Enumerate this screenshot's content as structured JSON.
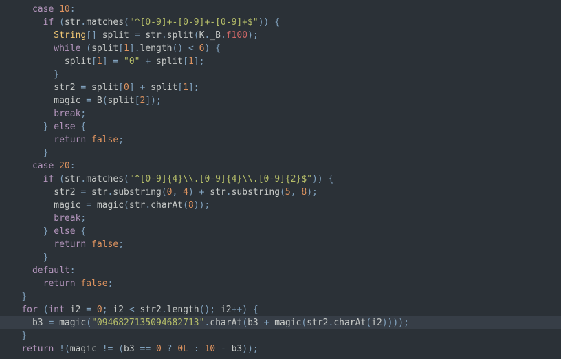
{
  "code": {
    "l1": "      case 10:",
    "l2": "        if (str.matches(\"^[0-9]+-[0-9]+-[0-9]+$\")) {",
    "l3": "          String[] split = str.split(K._B.f100);",
    "l4": "          while (split[1].length() < 6) {",
    "l5": "            split[1] = \"0\" + split[1];",
    "l6": "          }",
    "l7": "          str2 = split[0] + split[1];",
    "l8": "          magic = B(split[2]);",
    "l9": "          break;",
    "l10": "        } else {",
    "l11": "          return false;",
    "l12": "        }",
    "l13": "      case 20:",
    "l14": "        if (str.matches(\"^[0-9]{4}\\\\.[0-9]{4}\\\\.[0-9]{2}$\")) {",
    "l15": "          str2 = str.substring(0, 4) + str.substring(5, 8);",
    "l16": "          magic = magic(str.charAt(8));",
    "l17": "          break;",
    "l18": "        } else {",
    "l19": "          return false;",
    "l20": "        }",
    "l21": "      default:",
    "l22": "        return false;",
    "l23": "    }",
    "l24": "    for (int i2 = 0; i2 < str2.length(); i2++) {",
    "l25": "      b3 = magic(\"0946827135094682713\".charAt(b3 + magic(str2.charAt(i2))));",
    "l26": "    }",
    "l27": "    return !(magic != (b3 == 0 ? 0L : 10 - b3));"
  }
}
